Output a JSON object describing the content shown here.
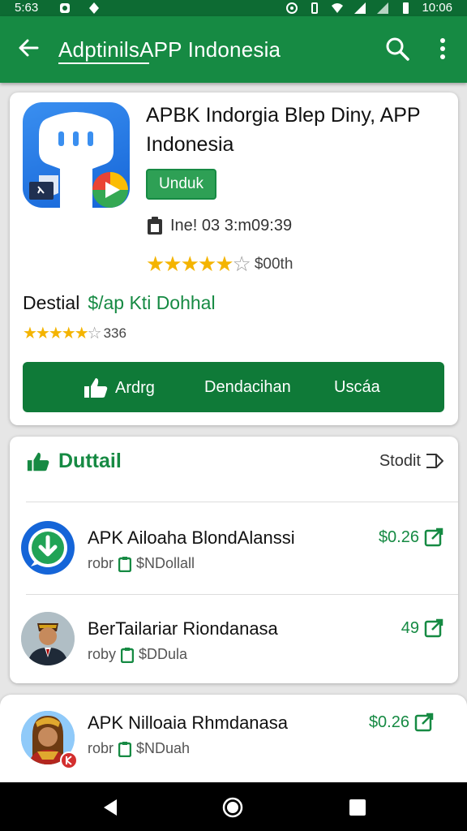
{
  "status_bar": {
    "time_left": "5:63",
    "time_right": "10:06"
  },
  "app_bar": {
    "title": "AdptinilsAPP Indonesia"
  },
  "featured": {
    "title": "APBK Indorgia Blep Diny, APP Indonesia",
    "install_label": "Unduk",
    "meta": "Ine! 03 3:m09:39",
    "rating_count": "$00th",
    "detail_label": "Destial",
    "detail_value": "$/ap Kti Dohhal",
    "rating2_count": "336",
    "actions": [
      "Ardrg",
      "Dendacihan",
      "Uscáa"
    ],
    "colors": {
      "primary": "#168a43",
      "star": "#f4b400"
    }
  },
  "section": {
    "title": "Duttail",
    "link": "Stodit",
    "items": [
      {
        "name": "APK Ailoaha BlondAlanssi",
        "prefix": "robr",
        "sub": "$NDollall",
        "price": "$0.26",
        "avatar": "download-icon"
      },
      {
        "name": "BerTailariar Riondanasa",
        "prefix": "roby",
        "sub": "$DDula",
        "price": "49",
        "avatar": "person-avatar"
      }
    ]
  },
  "bottom_item": {
    "name": "APK Nilloaia Rhmdanasa",
    "prefix": "robr",
    "sub": "$NDuah",
    "price": "$0.26",
    "avatar": "person-avatar"
  }
}
